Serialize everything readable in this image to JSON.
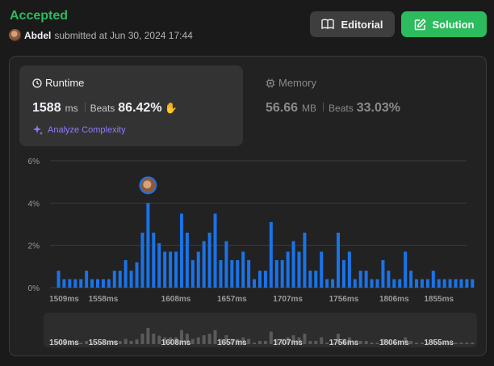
{
  "submission": {
    "status": "Accepted",
    "user": "Abdel",
    "submitted_text": "submitted at Jun 30, 2024 17:44"
  },
  "buttons": {
    "editorial": "Editorial",
    "solution": "Solution"
  },
  "runtime": {
    "title": "Runtime",
    "value": "1588",
    "unit": "ms",
    "beats_label": "Beats",
    "beats_value": "86.42%",
    "analyze": "Analyze Complexity"
  },
  "memory": {
    "title": "Memory",
    "value": "56.66",
    "unit": "MB",
    "beats_label": "Beats",
    "beats_value": "33.03%"
  },
  "colors": {
    "accepted": "#2cbb5d",
    "bar": "#1a73e8",
    "analyze": "#8e7cff",
    "mini_bar": "#5a5a5a"
  },
  "chart_data": {
    "type": "bar",
    "ylim": [
      0,
      6
    ],
    "y_ticks": [
      "0%",
      "2%",
      "4%",
      "6%"
    ],
    "y_tick_values": [
      0,
      2,
      4,
      6
    ],
    "x_tick_labels": [
      "1509ms",
      "1558ms",
      "1608ms",
      "1657ms",
      "1707ms",
      "1756ms",
      "1806ms",
      "1855ms"
    ],
    "x_tick_index": [
      1,
      8,
      21,
      31,
      41,
      51,
      60,
      68
    ],
    "highlight_index": 16,
    "values": [
      0.8,
      0.4,
      0.4,
      0.4,
      0.4,
      0.8,
      0.4,
      0.4,
      0.4,
      0.4,
      0.8,
      0.8,
      1.3,
      0.8,
      1.2,
      2.6,
      4.0,
      2.6,
      2.1,
      1.7,
      1.7,
      1.7,
      3.5,
      2.6,
      1.3,
      1.7,
      2.2,
      2.6,
      3.5,
      1.3,
      2.2,
      1.3,
      1.3,
      1.7,
      1.3,
      0.4,
      0.8,
      0.8,
      3.1,
      1.3,
      1.3,
      1.7,
      2.2,
      1.7,
      2.6,
      0.8,
      0.8,
      1.7,
      0.4,
      0.4,
      2.6,
      1.3,
      1.7,
      0.4,
      0.8,
      0.8,
      0.4,
      0.4,
      1.3,
      0.8,
      0.4,
      0.4,
      1.7,
      0.8,
      0.4,
      0.4,
      0.4,
      0.8,
      0.4,
      0.4,
      0.4,
      0.4,
      0.4,
      0.4,
      0.4
    ]
  }
}
